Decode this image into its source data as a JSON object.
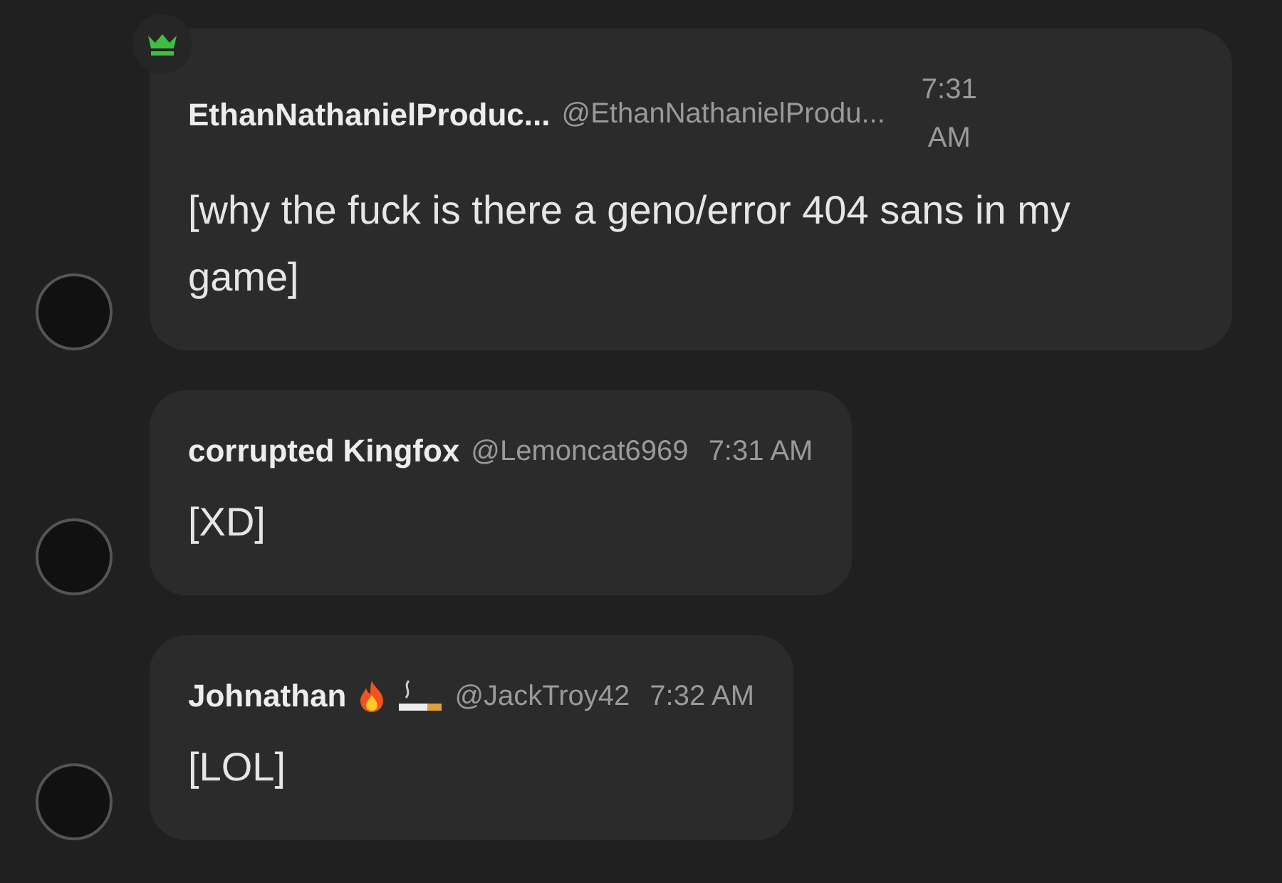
{
  "messages": [
    {
      "crown": true,
      "name": "EthanNathanielProduc...",
      "handle": "@EthanNathanielProdu...",
      "time": "7:31 AM",
      "text": "[why the fuck is there a geno/error 404 sans in my game]"
    },
    {
      "crown": false,
      "name": "corrupted Kingfox",
      "handle": "@Lemoncat6969",
      "time": "7:31 AM",
      "text": "[XD]"
    },
    {
      "crown": false,
      "name": "Johnathan",
      "badges": [
        {
          "kind": "flame"
        },
        {
          "kind": "cigarette"
        }
      ],
      "handle": "@JackTroy42",
      "time": "7:32 AM",
      "text": "[LOL]"
    }
  ]
}
